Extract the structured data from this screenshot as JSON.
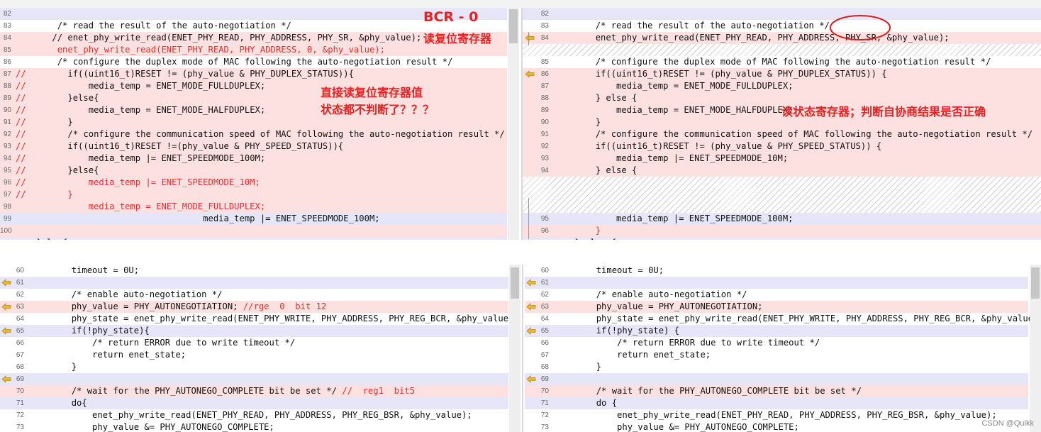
{
  "arrow_color": "#e8b830",
  "highlight_colors": {
    "changed": "#fde0e0",
    "context": "#e6e6f8",
    "comment_red": "#e23030",
    "annotation_red": "#e52222"
  },
  "top_left": {
    "rows": [
      {
        "num": "82",
        "code": "",
        "bg": "lav"
      },
      {
        "num": "83",
        "code": "        /* read the result of the auto-negotiation */",
        "bg": ""
      },
      {
        "num": "84",
        "code": "       // enet_phy_write_read(ENET_PHY_READ, PHY_ADDRESS, PHY_SR, &phy_value);",
        "bg": "pink"
      },
      {
        "num": "85",
        "code": "        enet_phy_write_read(ENET_PHY_READ, PHY_ADDRESS, 0, &phy_value);",
        "bg": "pink",
        "red": true
      },
      {
        "num": "86",
        "code": "        /* configure the duplex mode of MAC following the auto-negotiation result */",
        "bg": ""
      },
      {
        "num": "87",
        "code": "//        if((uint16_t)RESET != (phy_value & PHY_DUPLEX_STATUS)){",
        "bg": "pink",
        "lred": true
      },
      {
        "num": "88",
        "code": "//            media_temp = ENET_MODE_FULLDUPLEX;",
        "bg": "pink",
        "lred": true
      },
      {
        "num": "89",
        "code": "//        }else{",
        "bg": "pink",
        "lred": true
      },
      {
        "num": "90",
        "code": "//            media_temp = ENET_MODE_HALFDUPLEX;",
        "bg": "pink",
        "lred": true
      },
      {
        "num": "91",
        "code": "//        }",
        "bg": "pink",
        "lred": true
      },
      {
        "num": "92",
        "code": "//        /* configure the communication speed of MAC following the auto-negotiation result */",
        "bg": "pink",
        "lred": true
      },
      {
        "num": "93",
        "code": "//        if((uint16_t)RESET !=(phy_value & PHY_SPEED_STATUS)){",
        "bg": "pink",
        "lred": true
      },
      {
        "num": "94",
        "code": "//            media_temp |= ENET_SPEEDMODE_100M;",
        "bg": "pink",
        "lred": true
      },
      {
        "num": "95",
        "code": "//        }else{",
        "bg": "pink",
        "lred": true
      },
      {
        "num": "96",
        "code": "//            media_temp |= ENET_SPEEDMODE_10M;",
        "bg": "pink",
        "red": true
      },
      {
        "num": "97",
        "code": "//        }",
        "bg": "pink",
        "red": true
      },
      {
        "num": "98",
        "code": "              media_temp = ENET_MODE_FULLDUPLEX;",
        "bg": "pink",
        "red": true
      },
      {
        "num": "99",
        "code": "                                    media_temp |= ENET_SPEEDMODE_100M;",
        "bg": "lav"
      },
      {
        "num": "100",
        "code": "",
        "bg": "pink"
      },
      {
        "num": "101",
        "code": "    }else{",
        "bg": "lav"
      }
    ]
  },
  "top_right": {
    "rows": [
      {
        "num": "82",
        "code": "",
        "bg": "lav"
      },
      {
        "num": "83",
        "code": "        /* read the result of the auto-negotiation */",
        "bg": ""
      },
      {
        "num": "84",
        "code": "        enet_phy_write_read(ENET_PHY_READ, PHY_ADDRESS, PHY_SR, &phy_value);",
        "bg": "pink",
        "arrow": true
      },
      {
        "num": "",
        "code": "",
        "bg": "hatch"
      },
      {
        "num": "85",
        "code": "        /* configure the duplex mode of MAC following the auto-negotiation result */",
        "bg": ""
      },
      {
        "num": "86",
        "code": "        if((uint16_t)RESET != (phy_value & PHY_DUPLEX_STATUS)) {",
        "bg": "pink",
        "arrow": true
      },
      {
        "num": "87",
        "code": "            media_temp = ENET_MODE_FULLDUPLEX;",
        "bg": "pink"
      },
      {
        "num": "88",
        "code": "        } else {",
        "bg": "pink"
      },
      {
        "num": "89",
        "code": "            media_temp = ENET_MODE_HALFDUPLEX;",
        "bg": "pink"
      },
      {
        "num": "90",
        "code": "        }",
        "bg": "pink"
      },
      {
        "num": "91",
        "code": "        /* configure the communication speed of MAC following the auto-negotiation result */",
        "bg": "pink"
      },
      {
        "num": "92",
        "code": "        if((uint16_t)RESET != (phy_value & PHY_SPEED_STATUS)) {",
        "bg": "pink"
      },
      {
        "num": "93",
        "code": "            media_temp |= ENET_SPEEDMODE_10M;",
        "bg": "pink"
      },
      {
        "num": "94",
        "code": "        } else {",
        "bg": "pink"
      },
      {
        "num": "",
        "code": "",
        "bg": "hatch"
      },
      {
        "num": "",
        "code": "",
        "bg": "hatch"
      },
      {
        "num": "",
        "code": "",
        "bg": "hatch"
      },
      {
        "num": "95",
        "code": "            media_temp |= ENET_SPEEDMODE_100M;",
        "bg": "lav"
      },
      {
        "num": "96",
        "code": "        }",
        "bg": "pink",
        "red": true
      },
      {
        "num": "97",
        "code": "    } else {",
        "bg": "lav"
      }
    ]
  },
  "bottom_left": {
    "rows": [
      {
        "num": "60",
        "code": "        timeout = 0U;",
        "bg": ""
      },
      {
        "num": "61",
        "code": "",
        "bg": "lav",
        "arrow": true
      },
      {
        "num": "62",
        "code": "        /* enable auto-negotiation */",
        "bg": ""
      },
      {
        "num": "63",
        "code": "        phy_value = PHY_AUTONEGOTIATION; //rge  0  bit 12",
        "bg": "pink",
        "arrow": true,
        "tail": "//rge  0  bit 12"
      },
      {
        "num": "64",
        "code": "        phy_state = enet_phy_write_read(ENET_PHY_WRITE, PHY_ADDRESS, PHY_REG_BCR, &phy_value);",
        "bg": ""
      },
      {
        "num": "65",
        "code": "        if(!phy_state){",
        "bg": "lav",
        "arrow": true
      },
      {
        "num": "66",
        "code": "            /* return ERROR due to write timeout */",
        "bg": ""
      },
      {
        "num": "67",
        "code": "            return enet_state;",
        "bg": ""
      },
      {
        "num": "68",
        "code": "        }",
        "bg": ""
      },
      {
        "num": "69",
        "code": "",
        "bg": "lav",
        "arrow": true
      },
      {
        "num": "70",
        "code": "        /* wait for the PHY_AUTONEGO_COMPLETE bit be set */ //  reg1  bit5",
        "bg": "pink",
        "tail": "//  reg1  bit5"
      },
      {
        "num": "71",
        "code": "        do{",
        "bg": "lav"
      },
      {
        "num": "72",
        "code": "            enet_phy_write_read(ENET_PHY_READ, PHY_ADDRESS, PHY_REG_BSR, &phy_value);",
        "bg": ""
      },
      {
        "num": "73",
        "code": "            phy_value &= PHY_AUTONEGO_COMPLETE;",
        "bg": ""
      }
    ]
  },
  "bottom_right": {
    "rows": [
      {
        "num": "60",
        "code": "        timeout = 0U;",
        "bg": ""
      },
      {
        "num": "61",
        "code": "",
        "bg": "lav",
        "arrow": true
      },
      {
        "num": "62",
        "code": "        /* enable auto-negotiation */",
        "bg": ""
      },
      {
        "num": "63",
        "code": "        phy_value = PHY_AUTONEGOTIATION;",
        "bg": "pink",
        "arrow": true
      },
      {
        "num": "64",
        "code": "        phy_state = enet_phy_write_read(ENET_PHY_WRITE, PHY_ADDRESS, PHY_REG_BCR, &phy_value);",
        "bg": ""
      },
      {
        "num": "65",
        "code": "        if(!phy_state) {",
        "bg": "lav",
        "arrow": true
      },
      {
        "num": "66",
        "code": "            /* return ERROR due to write timeout */",
        "bg": ""
      },
      {
        "num": "67",
        "code": "            return enet_state;",
        "bg": ""
      },
      {
        "num": "68",
        "code": "        }",
        "bg": ""
      },
      {
        "num": "69",
        "code": "",
        "bg": "lav",
        "arrow": true
      },
      {
        "num": "70",
        "code": "        /* wait for the PHY_AUTONEGO_COMPLETE bit be set */",
        "bg": "pink"
      },
      {
        "num": "71",
        "code": "        do {",
        "bg": "lav"
      },
      {
        "num": "72",
        "code": "            enet_phy_write_read(ENET_PHY_READ, PHY_ADDRESS, PHY_REG_BSR, &phy_value);",
        "bg": ""
      },
      {
        "num": "73",
        "code": "            phy_value &= PHY_AUTONEGO_COMPLETE;",
        "bg": ""
      }
    ]
  },
  "annotations": {
    "bcr_title": "BCR - 0",
    "bcr_sub": "读复位寄存器",
    "direct_line1": "直接读复位寄存器值",
    "direct_line2": "状态都不判断了？？？",
    "status_note": "读状态寄存器；判断自协商结果是否正确"
  },
  "watermark": "CSDN @Quikk"
}
